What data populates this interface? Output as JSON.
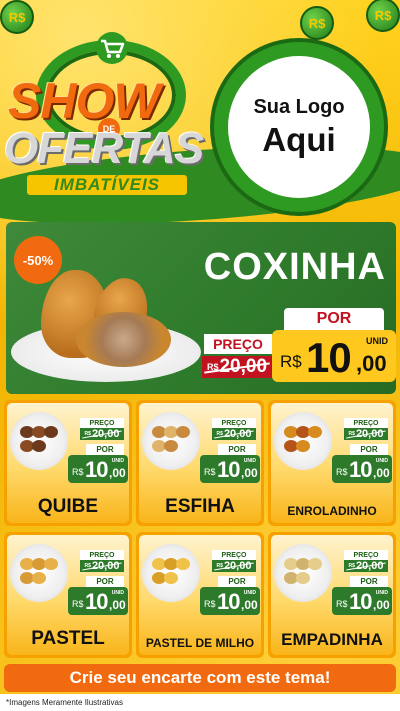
{
  "header": {
    "brand_show": "SHOW",
    "brand_de": "DE",
    "brand_ofertas": "OFERTAS",
    "brand_sub": "IMBATÍVEIS",
    "coin_symbol": "R$",
    "logo_line1": "Sua Logo",
    "logo_line2": "Aqui",
    "colors": {
      "green": "#2f9a22",
      "orange": "#f26a0f",
      "yellow": "#f3b700"
    }
  },
  "featured": {
    "discount": "-50%",
    "name": "COXINHA",
    "preco_label": "PREÇO",
    "old_currency": "R$",
    "old_price": "20,00",
    "por_label": "POR",
    "currency": "R$",
    "price_int": "10",
    "price_cents": ",00",
    "unit": "UNID"
  },
  "products": [
    {
      "name": "QUIBE",
      "preco_label": "PREÇO",
      "old_currency": "R$",
      "old_price": "20,00",
      "por_label": "POR",
      "currency": "R$",
      "price_int": "10",
      "price_cents": ",00",
      "unit": "UNID"
    },
    {
      "name": "ESFIHA",
      "preco_label": "PREÇO",
      "old_currency": "R$",
      "old_price": "20,00",
      "por_label": "POR",
      "currency": "R$",
      "price_int": "10",
      "price_cents": ",00",
      "unit": "UNID"
    },
    {
      "name": "ENROLADINHO",
      "preco_label": "PREÇO",
      "old_currency": "R$",
      "old_price": "20,00",
      "por_label": "POR",
      "currency": "R$",
      "price_int": "10",
      "price_cents": ",00",
      "unit": "UNID"
    },
    {
      "name": "PASTEL",
      "preco_label": "PREÇO",
      "old_currency": "R$",
      "old_price": "20,00",
      "por_label": "POR",
      "currency": "R$",
      "price_int": "10",
      "price_cents": ",00",
      "unit": "UNID"
    },
    {
      "name": "PASTEL DE MILHO",
      "preco_label": "PREÇO",
      "old_currency": "R$",
      "old_price": "20,00",
      "por_label": "POR",
      "currency": "R$",
      "price_int": "10",
      "price_cents": ",00",
      "unit": "UNID"
    },
    {
      "name": "EMPADINHA",
      "preco_label": "PREÇO",
      "old_currency": "R$",
      "old_price": "20,00",
      "por_label": "POR",
      "currency": "R$",
      "price_int": "10",
      "price_cents": ",00",
      "unit": "UNID"
    }
  ],
  "cta": {
    "label": "Crie seu encarte com este tema!"
  },
  "footer": {
    "disclaimer": "*Imagens Meramente Ilustrativas"
  }
}
